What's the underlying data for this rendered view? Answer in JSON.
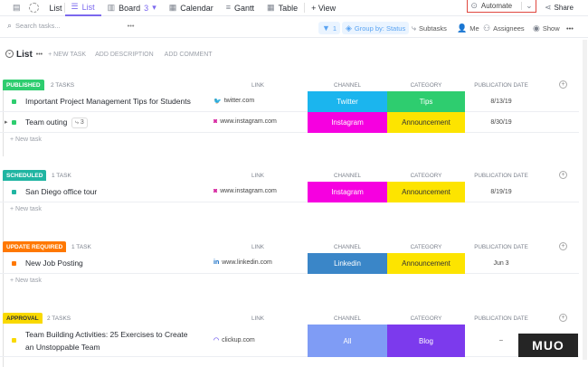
{
  "topbar": {
    "list_icon_label": "List",
    "list_label": "List",
    "board_label": "Board",
    "board_count": "3",
    "calendar_label": "Calendar",
    "gantt_label": "Gantt",
    "table_label": "Table",
    "view_label": "+ View",
    "automate_label": "Automate",
    "share_label": "Share"
  },
  "toolbar": {
    "search_placeholder": "Search tasks...",
    "filter_count": "1",
    "groupby_label": "Group by: Status",
    "subtasks_label": "Subtasks",
    "me_label": "Me",
    "assignees_label": "Assignees",
    "show_label": "Show"
  },
  "listhead": {
    "title": "List",
    "new_task": "+ NEW TASK",
    "add_description": "ADD DESCRIPTION",
    "add_comment": "ADD COMMENT"
  },
  "columns": {
    "link": "LINK",
    "channel": "CHANNEL",
    "category": "CATEGORY",
    "publication_date": "PUBLICATION DATE"
  },
  "new_task": "+ New task",
  "groups": [
    {
      "name": "PUBLISHED",
      "color": "#2ecd6f",
      "count": "2 TASKS",
      "tasks": [
        {
          "name": "Important Project Management Tips for Students",
          "dot": "#2ecd6f",
          "link": "twitter.com",
          "link_icon": "twitter-icon",
          "channel": "Twitter",
          "channel_color": "#1bb5ee",
          "category": "Tips",
          "category_color": "#2ecd6f",
          "date": "8/13/19"
        },
        {
          "name": "Team outing",
          "dot": "#2ecd6f",
          "subtasks": "3",
          "link": "www.instagram.com",
          "link_icon": "instagram-icon",
          "channel": "Instagram",
          "channel_color": "#f600e0",
          "category": "Announcement",
          "category_color": "#fde400",
          "date": "8/30/19"
        }
      ]
    },
    {
      "name": "SCHEDULED",
      "color": "#20b5a2",
      "count": "1 TASK",
      "tasks": [
        {
          "name": "San Diego office tour",
          "dot": "#20b5a2",
          "link": "www.instagram.com",
          "link_icon": "instagram-icon",
          "channel": "Instagram",
          "channel_color": "#f600e0",
          "category": "Announcement",
          "category_color": "#fde400",
          "date": "8/19/19"
        }
      ]
    },
    {
      "name": "UPDATE REQUIRED",
      "color": "#ff7800",
      "count": "1 TASK",
      "tasks": [
        {
          "name": "New Job Posting",
          "dot": "#ff7800",
          "link": "www.linkedin.com",
          "link_icon": "linkedin-icon",
          "channel": "Linkedin",
          "channel_color": "#3a86c8",
          "category": "Announcement",
          "category_color": "#fde400",
          "date": "Jun 3"
        }
      ]
    },
    {
      "name": "APPROVAL",
      "color": "#f9d900",
      "count": "2 TASKS",
      "tasks": [
        {
          "name": "Team Building Activities: 25 Exercises to Create an Unstoppable Team",
          "dot": "#f9d900",
          "link": "clickup.com",
          "link_icon": "clickup-icon",
          "channel": "All",
          "channel_color": "#7f9cf5",
          "category": "Blog",
          "category_color": "#7c3aed",
          "date": "–"
        }
      ]
    }
  ],
  "watermark": "MUO"
}
